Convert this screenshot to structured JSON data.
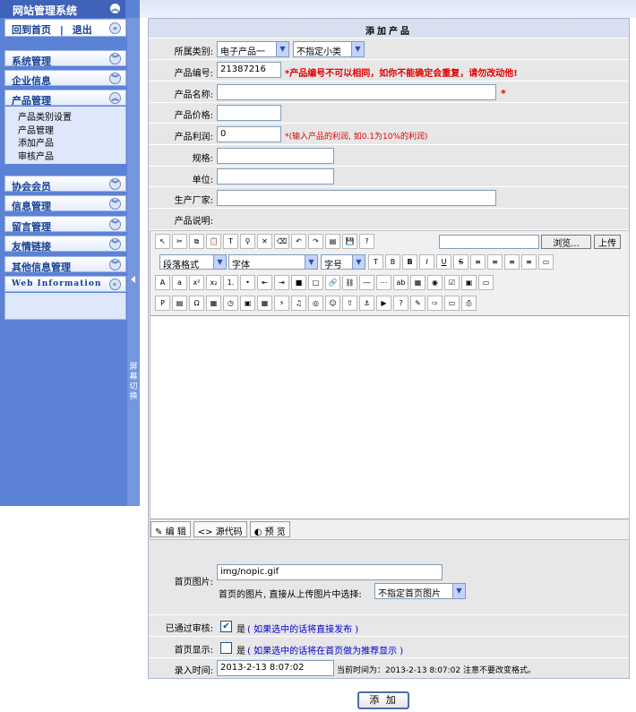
{
  "sidebar": {
    "title": "网站管理系统",
    "home": "回到首页",
    "sep": "|",
    "logout": "退出",
    "groups": [
      {
        "label": "系统管理"
      },
      {
        "label": "企业信息"
      },
      {
        "label": "产品管理",
        "items": [
          "产品类别设置",
          "产品管理",
          "添加产品",
          "审核产品"
        ]
      },
      {
        "label": "协会会员"
      },
      {
        "label": "信息管理"
      },
      {
        "label": "留言管理"
      },
      {
        "label": "友情链接"
      },
      {
        "label": "其他信息管理"
      },
      {
        "label": "Web Information"
      }
    ],
    "splitter": "屏幕切换"
  },
  "form": {
    "title": "添加产品",
    "category_label": "所属类别:",
    "category1": "电子产品一",
    "category2": "不指定小类",
    "code_label": "产品编号:",
    "code_value": "21387216",
    "code_note": "*产品编号不可以相同，如你不能确定会重复，请勿改动他!",
    "name_label": "产品名称:",
    "name_star": "*",
    "price_label": "产品价格:",
    "profit_label": "产品利润:",
    "profit_value": "0",
    "profit_note": "*(输入产品的利润, 如0.1为10%的利润)",
    "spec_label": "规格:",
    "unit_label": "单位:",
    "maker_label": "生产厂家:",
    "desc_label": "产品说明:",
    "browse": "浏览...",
    "upload": "上传",
    "para_format": "段落格式",
    "font": "字体",
    "font_size": "字号",
    "modes": [
      "编 辑",
      "源代码",
      "预 览"
    ],
    "pic_label": "首页图片:",
    "pic_value": "img/nopic.gif",
    "pic_hint": "首页的图片, 直接从上传图片中选择:",
    "pic_select": "不指定首页图片",
    "approved_label": "已通过审核:",
    "approved_yes": "是",
    "approved_note": "( 如果选中的话将直接发布 )",
    "home_label": "首页显示:",
    "home_yes": "是",
    "home_note": "( 如果选中的话将在首页做为推荐显示 )",
    "time_label": "录入时间:",
    "time_value": "2013-2-13 8:07:02",
    "time_now": "当前时间为：2013-2-13 8:07:02 注意不要改变格式。",
    "submit": "添 加"
  },
  "colors": {
    "sidebar": "#5c82d6",
    "title_bar": "#3e63b8",
    "required": "#e00000",
    "note": "#0000d0"
  }
}
